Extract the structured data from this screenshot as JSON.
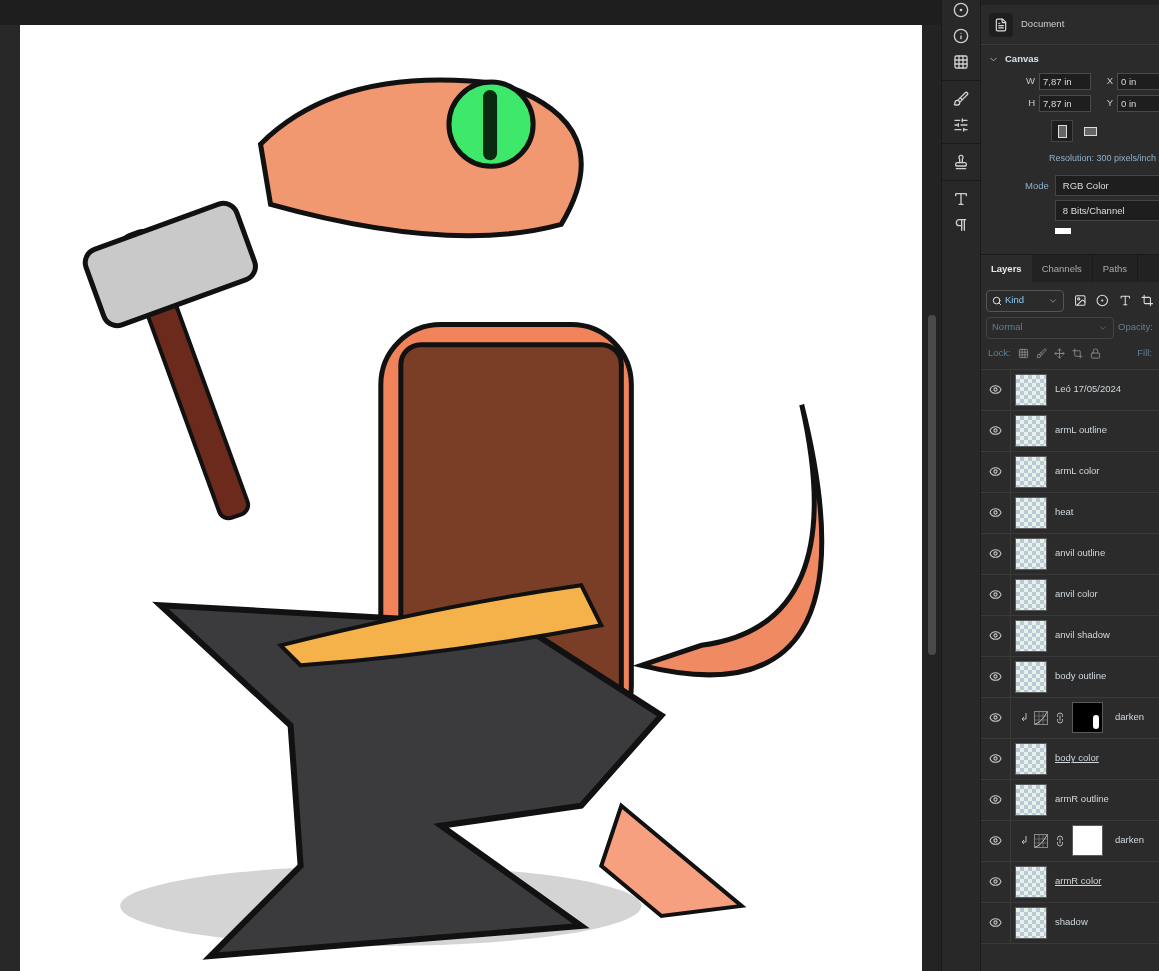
{
  "properties": {
    "section": "Document",
    "group": {
      "title": "Canvas",
      "expanded": true
    },
    "fields": [
      {
        "label": "W",
        "value": "7,87 in"
      },
      {
        "label": "X",
        "value": "0 in"
      },
      {
        "label": "H",
        "value": "7,87 in"
      },
      {
        "label": "Y",
        "value": "0 in"
      }
    ],
    "orientation": [
      {
        "kind": "portrait",
        "selected": true
      },
      {
        "kind": "landscape",
        "selected": false
      }
    ],
    "resolution": "Resolution: 300 pixels/inch",
    "mode_label": "Mode",
    "mode": "RGB Color",
    "depth": "8 Bits/Channel"
  },
  "layers_panel": {
    "tabs": [
      {
        "label": "Layers",
        "selected": true
      },
      {
        "label": "Channels",
        "selected": false
      },
      {
        "label": "Paths",
        "selected": false
      }
    ],
    "filter": "Kind",
    "blend_mode": "Normal",
    "opacity_label": "Opacity:",
    "lock_label": "Lock:",
    "fill_label": "Fill:",
    "layers": [
      {
        "name": "Leó 17/05/2024",
        "kind": "pixel",
        "visible": true,
        "clip_base": false
      },
      {
        "name": "armL outline",
        "kind": "pixel",
        "visible": true,
        "clip_base": false
      },
      {
        "name": "armL color",
        "kind": "pixel",
        "visible": true,
        "clip_base": false
      },
      {
        "name": "heat",
        "kind": "pixel",
        "visible": true,
        "clip_base": false
      },
      {
        "name": "anvil outline",
        "kind": "pixel",
        "visible": true,
        "clip_base": false
      },
      {
        "name": "anvil color",
        "kind": "pixel",
        "visible": true,
        "clip_base": false
      },
      {
        "name": "anvil shadow",
        "kind": "pixel",
        "visible": true,
        "clip_base": false
      },
      {
        "name": "body outline",
        "kind": "pixel",
        "visible": true,
        "clip_base": false
      },
      {
        "name": "darken",
        "kind": "adjustment",
        "visible": true,
        "mask_black": true
      },
      {
        "name": "body color",
        "kind": "pixel",
        "visible": true,
        "clip_base": true
      },
      {
        "name": "armR outline",
        "kind": "pixel",
        "visible": true,
        "clip_base": false
      },
      {
        "name": "darken",
        "kind": "adjustment",
        "visible": true,
        "mask_black": false
      },
      {
        "name": "armR color",
        "kind": "pixel",
        "visible": true,
        "clip_base": true
      },
      {
        "name": "shadow",
        "kind": "pixel",
        "visible": true,
        "clip_base": false
      }
    ]
  }
}
